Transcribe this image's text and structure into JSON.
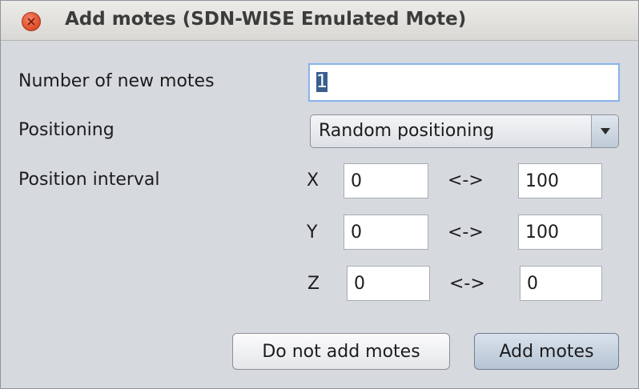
{
  "window": {
    "title": "Add motes (SDN-WISE Emulated Mote)"
  },
  "form": {
    "count_label": "Number of new motes",
    "count_value": "1",
    "positioning_label": "Positioning",
    "positioning_value": "Random positioning",
    "interval_label": "Position interval",
    "separator": "<->",
    "axes": [
      {
        "axis": "X",
        "min": "0",
        "max": "100"
      },
      {
        "axis": "Y",
        "min": "0",
        "max": "100"
      },
      {
        "axis": "Z",
        "min": "0",
        "max": "0"
      }
    ]
  },
  "buttons": {
    "cancel_label": "Do not add motes",
    "confirm_label": "Add motes"
  },
  "colors": {
    "close_button": "#dd4b26",
    "focus_ring": "#8db2e3",
    "selection": "#3a5f8e"
  },
  "icons": {
    "close": "close-icon",
    "dropdown": "chevron-down-icon"
  }
}
